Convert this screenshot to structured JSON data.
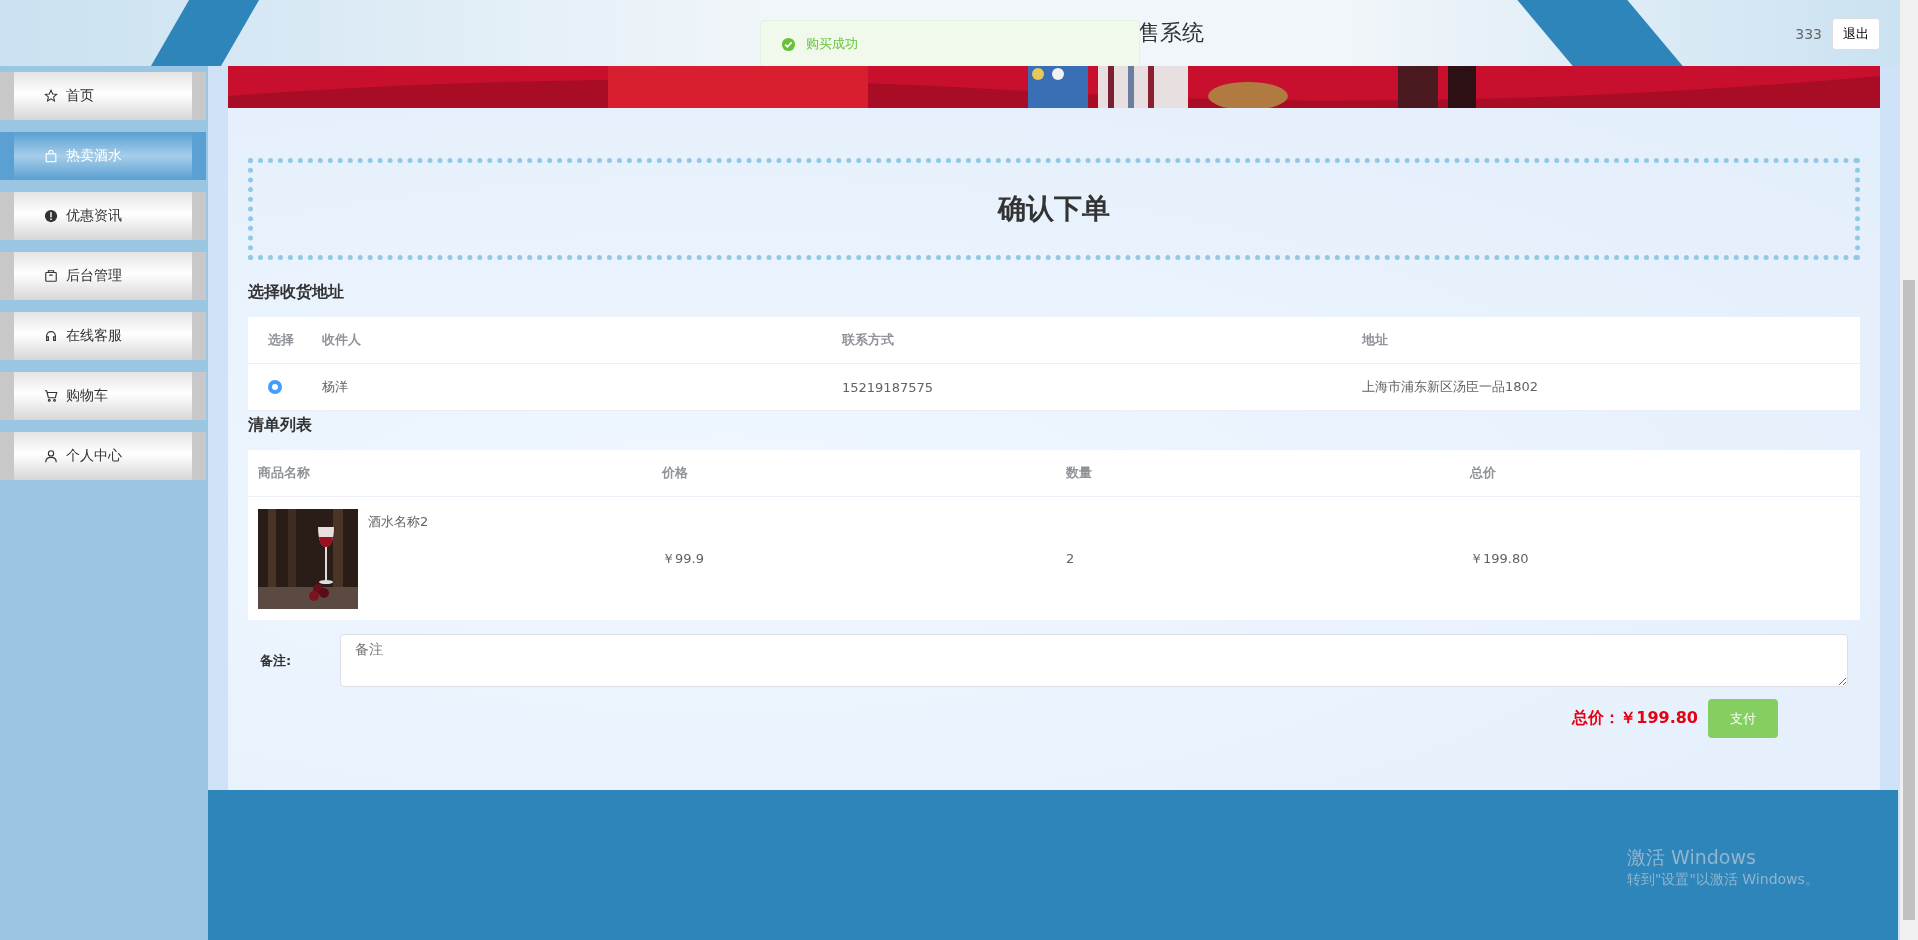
{
  "header": {
    "title_visible": "售系统",
    "username": "333",
    "logout": "退出"
  },
  "toast": {
    "kind": "success",
    "message": "购买成功"
  },
  "sidebar": {
    "items": [
      {
        "label": "首页",
        "selected": false
      },
      {
        "label": "热卖酒水",
        "selected": true
      },
      {
        "label": "优惠资讯",
        "selected": false
      },
      {
        "label": "后台管理",
        "selected": false
      },
      {
        "label": "在线客服",
        "selected": false
      },
      {
        "label": "购物车",
        "selected": false
      },
      {
        "label": "个人中心",
        "selected": false
      }
    ]
  },
  "page_title": "确认下单",
  "address_section": {
    "title": "选择收货地址",
    "columns": [
      "选择",
      "收件人",
      "联系方式",
      "地址"
    ],
    "rows": [
      {
        "selected": true,
        "name": "杨洋",
        "phone": "15219187575",
        "address": "上海市浦东新区汤臣一品1802"
      }
    ]
  },
  "list_section": {
    "title": "清单列表",
    "columns": [
      "商品名称",
      "价格",
      "数量",
      "总价"
    ],
    "rows": [
      {
        "name": "酒水名称2",
        "price": "￥99.9",
        "quantity": "2",
        "total": "￥199.80"
      }
    ]
  },
  "remark": {
    "label": "备注:",
    "placeholder": "备注"
  },
  "total": {
    "label": "总价：",
    "value": "￥199.80"
  },
  "pay_button": "支付",
  "os_notice": {
    "title": "激活 Windows",
    "subtitle": "转到\"设置\"以激活 Windows。"
  }
}
